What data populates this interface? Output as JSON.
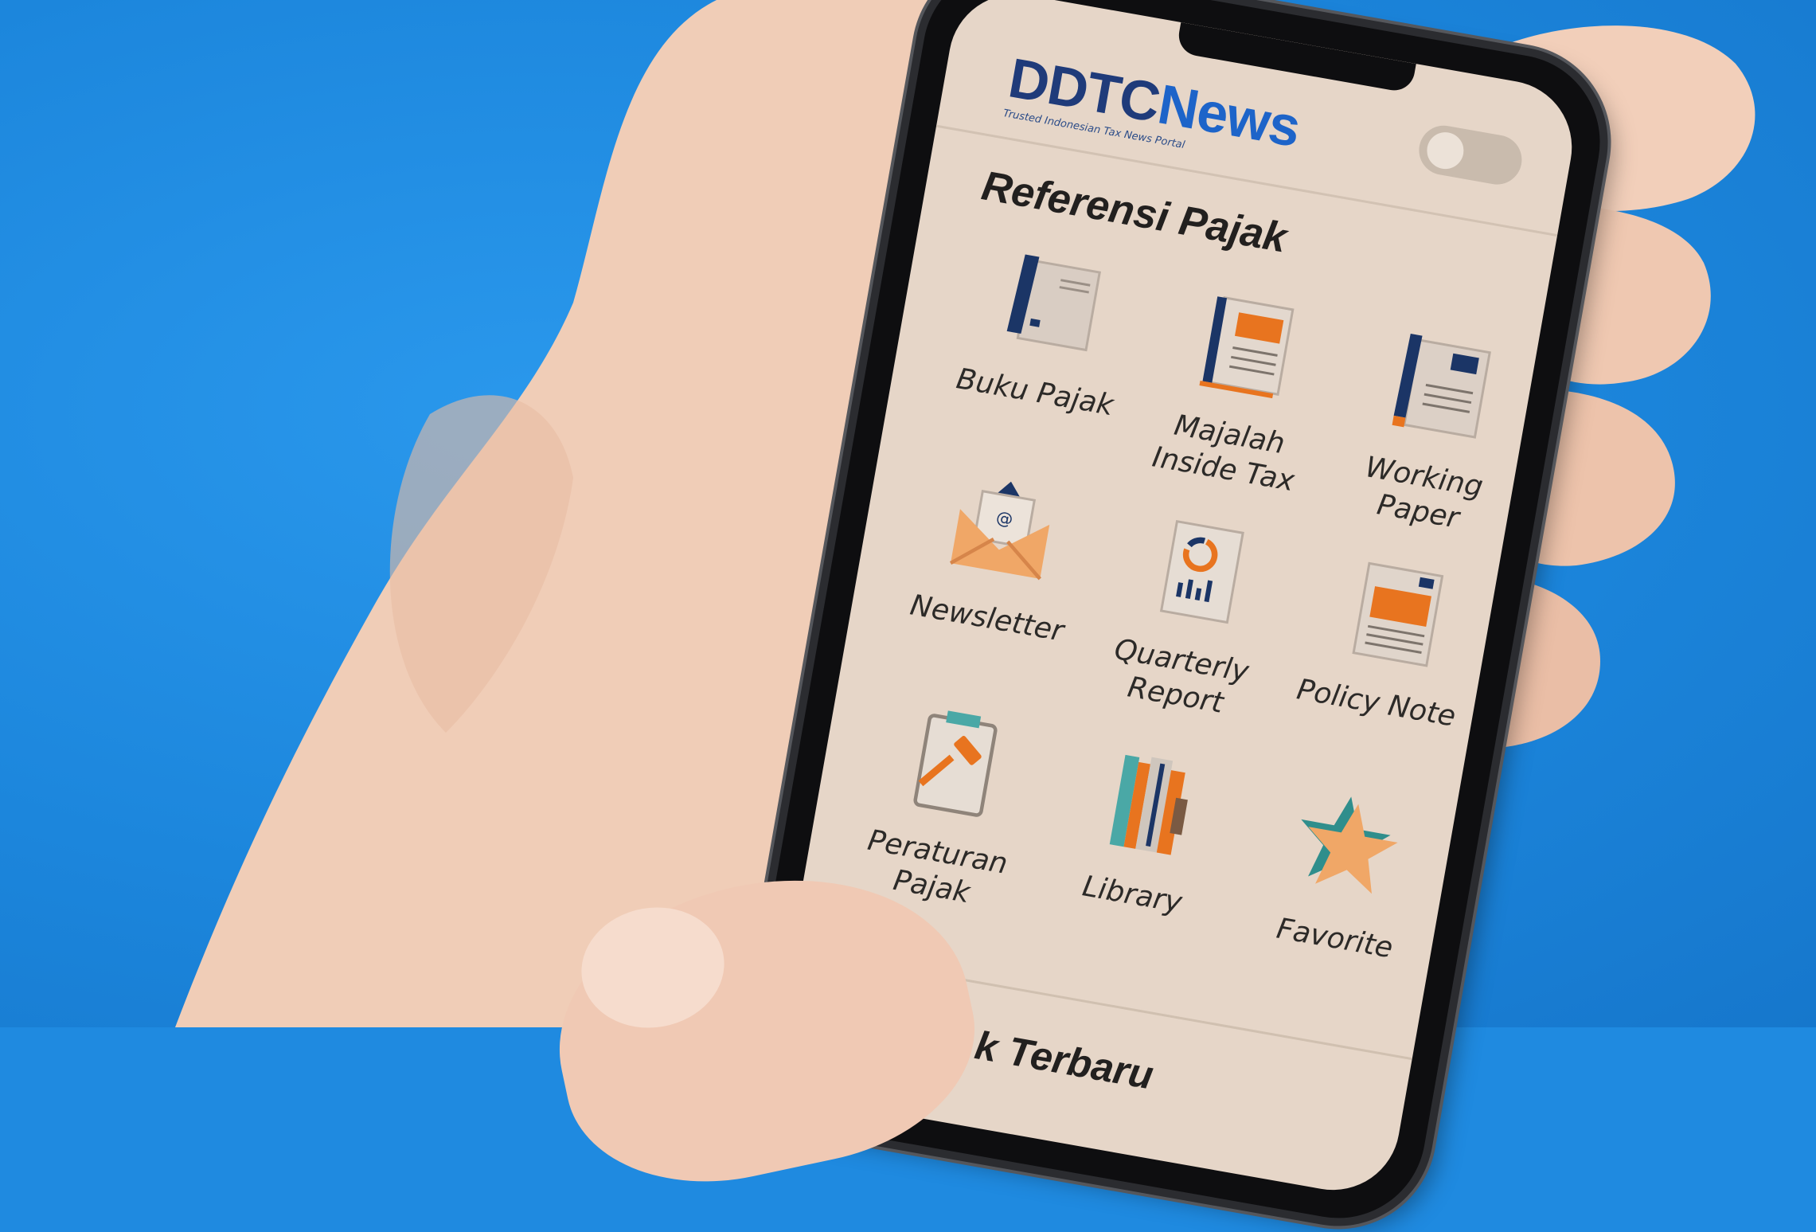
{
  "app": {
    "logo_text_dt": "DDTC",
    "logo_text_news": "News",
    "logo_tagline": "Trusted Indonesian Tax News Portal"
  },
  "header": {
    "theme_toggle": "off"
  },
  "referensi": {
    "title": "Referensi Pajak",
    "items": [
      {
        "label_1": "Buku Pajak",
        "label_2": "",
        "icon": "book-pen-icon"
      },
      {
        "label_1": "Majalah",
        "label_2": "Inside Tax",
        "icon": "magazine-icon"
      },
      {
        "label_1": "Working",
        "label_2": "Paper",
        "icon": "paper-pen-icon"
      },
      {
        "label_1": "Newsletter",
        "label_2": "",
        "icon": "envelope-icon"
      },
      {
        "label_1": "Quarterly",
        "label_2": "Report",
        "icon": "report-chart-icon"
      },
      {
        "label_1": "Policy Note",
        "label_2": "",
        "icon": "policy-note-icon"
      },
      {
        "label_1": "Peraturan",
        "label_2": "Pajak",
        "icon": "gavel-clipboard-icon"
      },
      {
        "label_1": "Library",
        "label_2": "",
        "icon": "library-books-icon"
      },
      {
        "label_1": "Favorite",
        "label_2": "",
        "icon": "star-icon"
      }
    ]
  },
  "latest": {
    "title": "Peratur      k Terbaru"
  },
  "colors": {
    "accent_orange": "#e8741f",
    "navy": "#1b3566",
    "screen_bg": "#e6d6c8",
    "background_blue": "#1f8ae0"
  }
}
